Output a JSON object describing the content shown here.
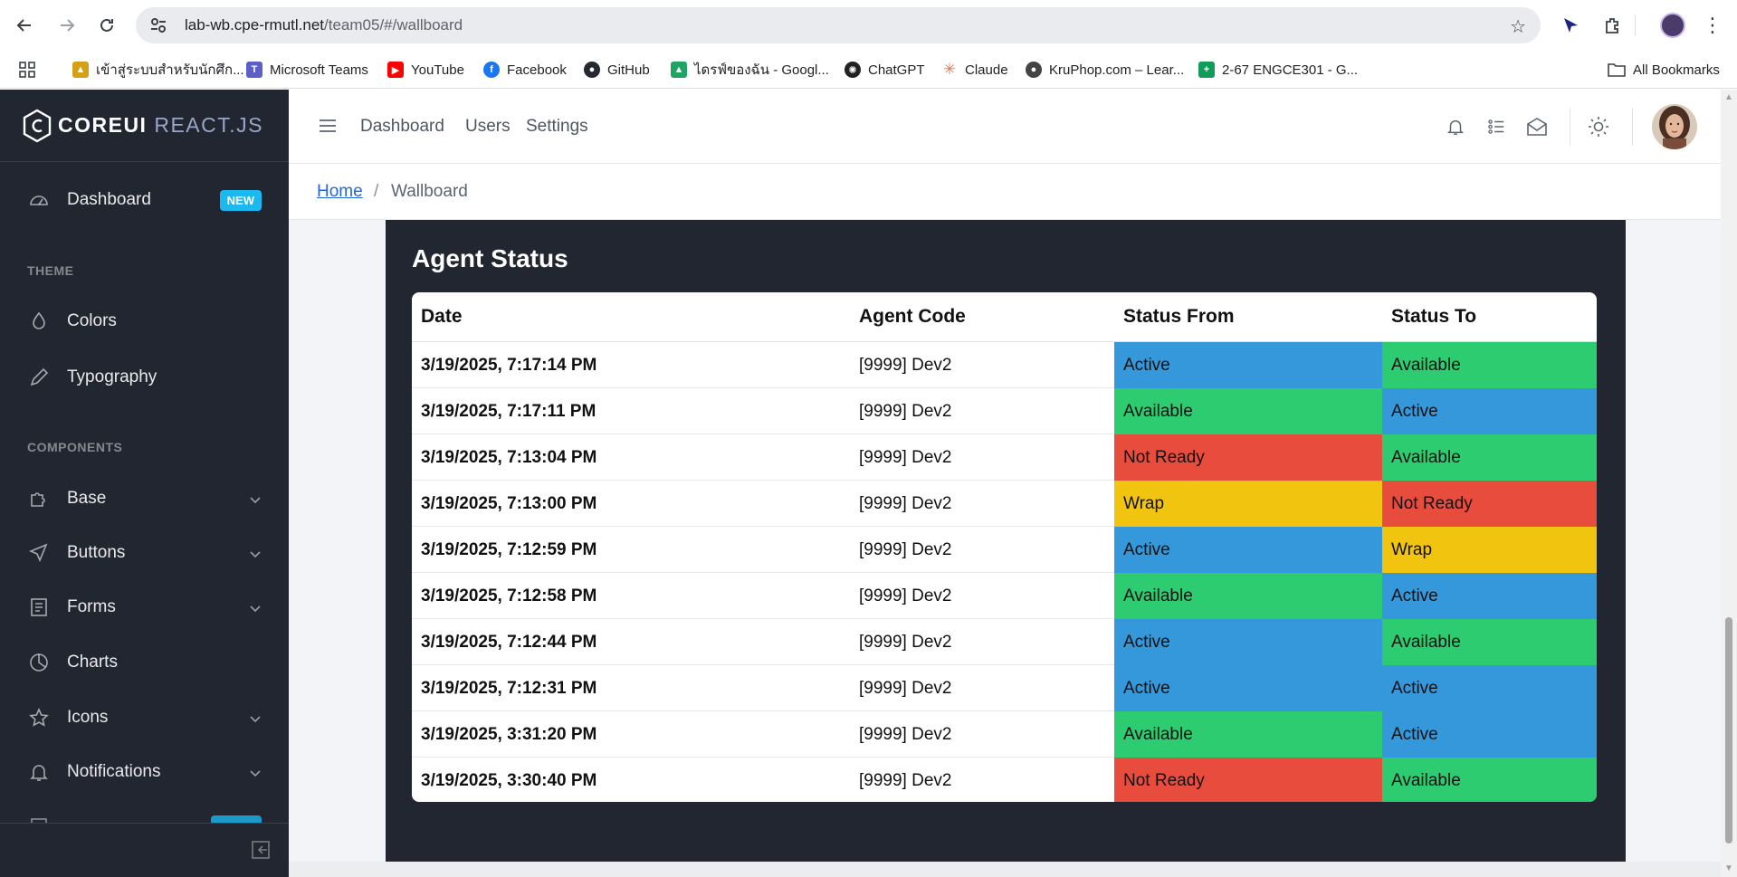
{
  "browser": {
    "url_host": "lab-wb.cpe-rmutl.net",
    "url_path": "/team05/#/wallboard",
    "bookmarks": [
      {
        "label": "เข้าสู่ระบบสำหรับนักศึก...",
        "icon": "temple-icon",
        "color": "#d4a017"
      },
      {
        "label": "Microsoft Teams",
        "icon": "teams-icon",
        "color": "#5b5fc7"
      },
      {
        "label": "YouTube",
        "icon": "youtube-icon",
        "color": "#ff0000"
      },
      {
        "label": "Facebook",
        "icon": "facebook-icon",
        "color": "#1877f2"
      },
      {
        "label": "GitHub",
        "icon": "github-icon",
        "color": "#24292f"
      },
      {
        "label": "ไดรฟ์ของฉัน - Googl...",
        "icon": "drive-icon",
        "color": "#1fa463"
      },
      {
        "label": "ChatGPT",
        "icon": "chatgpt-icon",
        "color": "#202123"
      },
      {
        "label": "Claude",
        "icon": "claude-icon",
        "color": "#d97757"
      },
      {
        "label": "KruPhop.com – Lear...",
        "icon": "kruphop-icon",
        "color": "#444444"
      },
      {
        "label": "2-67 ENGCE301 - G...",
        "icon": "sheets-icon",
        "color": "#0f9d58"
      }
    ],
    "all_bookmarks": "All Bookmarks"
  },
  "sidebar": {
    "brand_bold": "COREUI",
    "brand_light": " REACT.JS",
    "dashboard": {
      "label": "Dashboard",
      "badge": "NEW"
    },
    "section_theme": "THEME",
    "colors": "Colors",
    "typography": "Typography",
    "section_components": "COMPONENTS",
    "base": "Base",
    "buttons": "Buttons",
    "forms": "Forms",
    "charts": "Charts",
    "icons": "Icons",
    "notifications": "Notifications"
  },
  "header": {
    "links": [
      "Dashboard",
      "Users",
      "Settings"
    ]
  },
  "breadcrumb": {
    "home": "Home",
    "separator": "/",
    "current": "Wallboard"
  },
  "agent_status": {
    "title": "Agent Status",
    "columns": [
      "Date",
      "Agent Code",
      "Status From",
      "Status To"
    ],
    "status_colors": {
      "Active": "#3498db",
      "Available": "#2ecc71",
      "Not Ready": "#e74c3c",
      "Wrap": "#f1c40f"
    },
    "rows": [
      {
        "date": "3/19/2025, 7:17:14 PM",
        "agent": "[9999] Dev2",
        "from": "Active",
        "to": "Available"
      },
      {
        "date": "3/19/2025, 7:17:11 PM",
        "agent": "[9999] Dev2",
        "from": "Available",
        "to": "Active"
      },
      {
        "date": "3/19/2025, 7:13:04 PM",
        "agent": "[9999] Dev2",
        "from": "Not Ready",
        "to": "Available"
      },
      {
        "date": "3/19/2025, 7:13:00 PM",
        "agent": "[9999] Dev2",
        "from": "Wrap",
        "to": "Not Ready"
      },
      {
        "date": "3/19/2025, 7:12:59 PM",
        "agent": "[9999] Dev2",
        "from": "Active",
        "to": "Wrap"
      },
      {
        "date": "3/19/2025, 7:12:58 PM",
        "agent": "[9999] Dev2",
        "from": "Available",
        "to": "Active"
      },
      {
        "date": "3/19/2025, 7:12:44 PM",
        "agent": "[9999] Dev2",
        "from": "Active",
        "to": "Available"
      },
      {
        "date": "3/19/2025, 7:12:31 PM",
        "agent": "[9999] Dev2",
        "from": "Active",
        "to": "Active"
      },
      {
        "date": "3/19/2025, 3:31:20 PM",
        "agent": "[9999] Dev2",
        "from": "Available",
        "to": "Active"
      },
      {
        "date": "3/19/2025, 3:30:40 PM",
        "agent": "[9999] Dev2",
        "from": "Not Ready",
        "to": "Available"
      }
    ]
  }
}
